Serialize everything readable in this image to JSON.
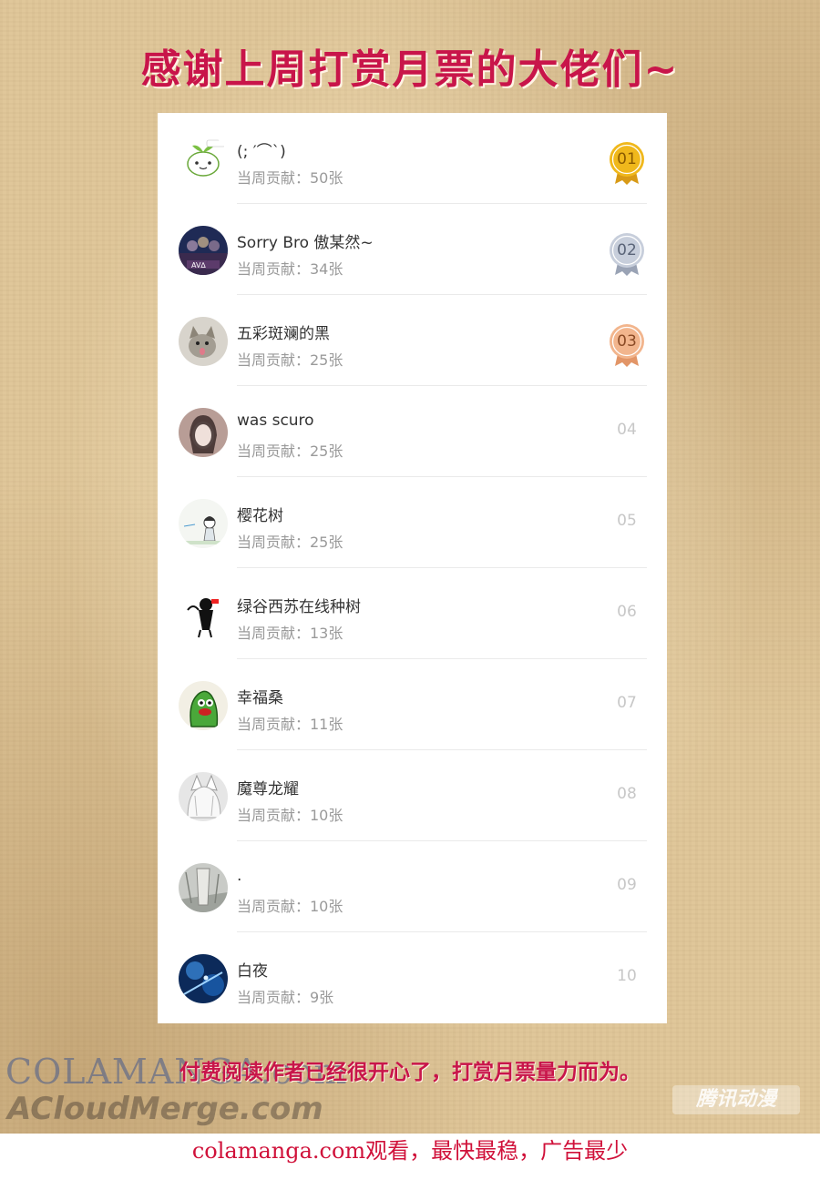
{
  "title": "感谢上周打赏月票的大佬们~",
  "contributors": [
    {
      "name": "(; ′⌒`)",
      "contribution": "当周贡献：50张",
      "rank": "01"
    },
    {
      "name": "Sorry Bro 傲某然~",
      "contribution": "当周贡献：34张",
      "rank": "02"
    },
    {
      "name": "五彩斑斓的黑",
      "contribution": "当周贡献：25张",
      "rank": "03"
    },
    {
      "name": "was  scuro",
      "contribution": "当周贡献：25张",
      "rank": "04"
    },
    {
      "name": "樱花树",
      "contribution": "当周贡献：25张",
      "rank": "05"
    },
    {
      "name": "绿谷西苏在线种树",
      "contribution": "当周贡献：13张",
      "rank": "06"
    },
    {
      "name": "幸福桑",
      "contribution": "当周贡献：11张",
      "rank": "07"
    },
    {
      "name": "魔尊龙耀",
      "contribution": "当周贡献：10张",
      "rank": "08"
    },
    {
      "name": ".",
      "contribution": "当周贡献：10张",
      "rank": "09"
    },
    {
      "name": "白夜",
      "contribution": "当周贡献：9张",
      "rank": "10"
    }
  ],
  "medal_colors": {
    "gold": "#f0b81c",
    "silver": "#c7cedb",
    "bronze": "#f2b58d"
  },
  "footer_note": "付费阅读作者已经很开心了，打赏月票量力而为。",
  "watermarks": {
    "colamanga": "COLAMANGA.com",
    "acloud": "ACloudMerge.com",
    "tencent": "腾讯动漫"
  },
  "bottom_banner": "colamanga.com观看，最快最稳，广告最少",
  "colors": {
    "title": "#c8154a",
    "paper": "#e0c79a",
    "bottom_text": "#d0113a"
  }
}
